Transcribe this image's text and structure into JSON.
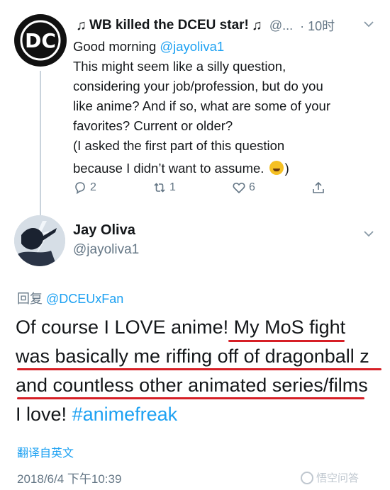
{
  "tweet1": {
    "display_name": "WB killed the DCEU star!",
    "handle": "@...",
    "time": "· 10时",
    "body_lines": [
      "This might seem like a silly question,",
      "considering your job/profession, but do you",
      "like anime? And if so, what are some of your",
      "favorites? Current or older?",
      "(I asked the first part of this question"
    ],
    "greeting": "Good morning",
    "mention": "@jayoliva1",
    "last_line_before_emoji": "because I didn’t want to assume.",
    "last_line_after_emoji": ")",
    "reply_count": "2",
    "retweet_count": "1",
    "like_count": "6",
    "avatar_logo_text": "DC"
  },
  "tweet2": {
    "display_name": "Jay Oliva",
    "handle": "@jayoliva1",
    "replying_prefix": "回复",
    "replying_to": "@DCEUxFan",
    "text_lines": [
      "Of course I LOVE anime! My MoS fight",
      "was basically me riffing off of dragonball z",
      "and countless other animated series/films"
    ],
    "last_line_prefix": "I love!",
    "hashtag": "#animefreak",
    "translate_label": "翻译自英文",
    "date": "2018/6/4 下午10:39",
    "underline_color": "#d61f26"
  },
  "watermark": {
    "text": "悟空问答"
  },
  "colors": {
    "accent": "#1da1f2",
    "muted": "#657786",
    "text": "#14171a"
  }
}
